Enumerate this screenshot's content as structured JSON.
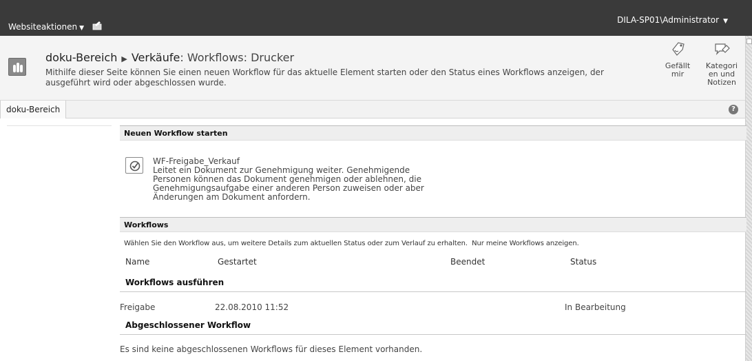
{
  "ribbon": {
    "site_actions_label": "Websiteaktionen",
    "user_label": "DILA-SP01\\Administrator"
  },
  "title_area": {
    "breadcrumb_site": "doku-Bereich",
    "breadcrumb_page": "Verkäufe",
    "breadcrumb_rest": ": Workflows: Drucker",
    "description": "Mithilfe dieser Seite können Sie einen neuen Workflow für das aktuelle Element starten oder den Status eines Workflows anzeigen, der ausgeführt wird oder abgeschlossen wurde.",
    "like_label": "Gefällt mir",
    "tags_label": "Kategori en und Notizen"
  },
  "topnav": {
    "tab_label": "doku-Bereich",
    "help_glyph": "?"
  },
  "start_section": {
    "heading": "Neuen Workflow starten",
    "workflow_name": "WF-Freigabe_Verkauf",
    "workflow_description": "Leitet ein Dokument zur Genehmigung weiter. Genehmigende Personen können das Dokument genehmigen oder ablehnen, die Genehmigungsaufgabe einer anderen Person zuweisen oder aber Änderungen am Dokument anfordern."
  },
  "workflows_section": {
    "heading": "Workflows",
    "note": "Wählen Sie den Workflow aus, um weitere Details zum aktuellen Status oder zum Verlauf zu erhalten.",
    "my_workflows_link": "Nur meine Workflows anzeigen.",
    "columns": [
      "Name",
      "Gestartet",
      "Beendet",
      "Status"
    ],
    "running_heading": "Workflows ausführen",
    "running_rows": [
      {
        "name": "Freigabe",
        "started": "22.08.2010 11:52",
        "ended": "",
        "status": "In Bearbeitung"
      }
    ],
    "completed_heading": "Abgeschlossener Workflow",
    "completed_empty": "Es sind keine abgeschlossenen Workflows für dieses Element vorhanden."
  }
}
